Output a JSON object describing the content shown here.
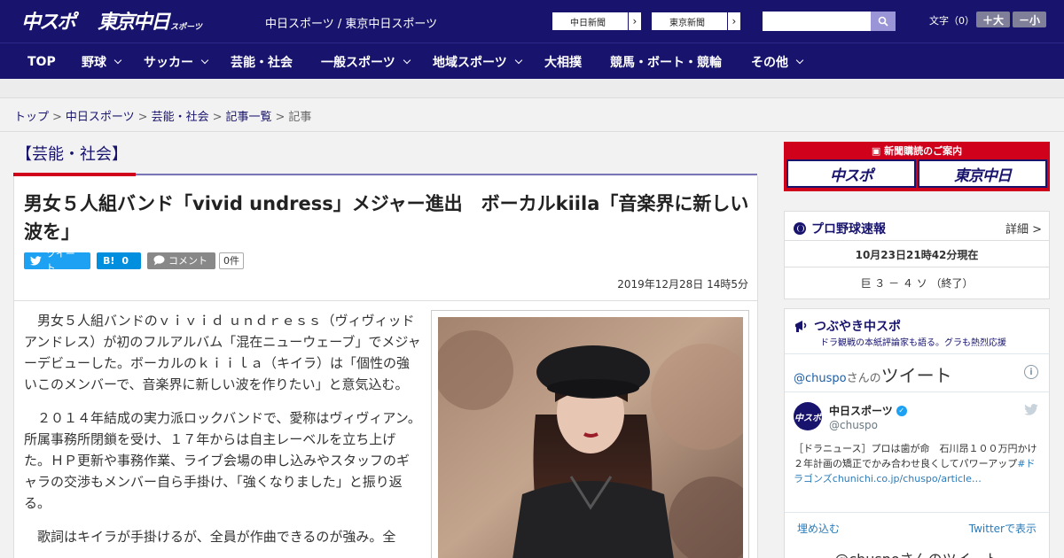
{
  "header": {
    "logo_chuspo": "中スポ",
    "logo_tokyo": "東京中日",
    "logo_tokyo_sub": "スポーツ",
    "site_title": "中日スポーツ / 東京中日スポーツ",
    "ext_links": [
      "中日新聞",
      "東京新聞"
    ],
    "search": {
      "placeholder": "",
      "value": ""
    },
    "font_label": "文字（0）",
    "font_big": "＋大",
    "font_small": "－小",
    "colors": {
      "navy": "#18146e",
      "red": "#d0021b"
    }
  },
  "nav": {
    "items": [
      {
        "label": "TOP",
        "has_menu": false
      },
      {
        "label": "野球",
        "has_menu": true
      },
      {
        "label": "サッカー",
        "has_menu": true
      },
      {
        "label": "芸能・社会",
        "has_menu": false
      },
      {
        "label": "一般スポーツ",
        "has_menu": true
      },
      {
        "label": "地域スポーツ",
        "has_menu": true
      },
      {
        "label": "大相撲",
        "has_menu": false
      },
      {
        "label": "競馬・ボート・競輪",
        "has_menu": false
      },
      {
        "label": "その他",
        "has_menu": true
      }
    ]
  },
  "breadcrumb": {
    "items": [
      "トップ",
      "中日スポーツ",
      "芸能・社会",
      "記事一覧"
    ],
    "current": "記事",
    "separator": ">"
  },
  "article": {
    "category": "【芸能・社会】",
    "headline": "男女５人組バンド「vivid undress」メジャー進出　ボーカルkiila「音楽界に新しい波を」",
    "share": {
      "tweet": "ツイート",
      "hatena": "B!",
      "hatena_count": "0",
      "comment": "コメント",
      "comment_count": "0件"
    },
    "date": "2019年12月28日 14時5分",
    "paragraphs": [
      "男女５人組バンドのｖｉｖｉｄ ｕｎｄｒｅｓｓ（ヴィヴィッドアンドレス）が初のフルアルバム「混在ニューウェーブ」でメジャーデビューした。ボーカルのｋｉｉｌａ（キイラ）は「個性の強いこのメンバーで、音楽界に新しい波を作りたい」と意気込む。",
      "２０１４年結成の実力派ロックバンドで、愛称はヴィヴィアン。所属事務所閉鎖を受け、１７年からは自主レーベルを立ち上げた。ＨＰ更新や事務作業、ライブ会場の申し込みやスタッフのギャラの交渉もメンバー自ら手掛け、「強くなりました」と振り返る。",
      "歌詞はキイラが手掛けるが、全員が作曲できるのが強み。全"
    ]
  },
  "sidebar": {
    "subscribe": {
      "caption": "新聞購読のご案内",
      "box1": "中スポ",
      "box2": "東京中日"
    },
    "baseball": {
      "title": "プロ野球速報",
      "more": "詳細 >",
      "updated": "10月23日21時42分現在",
      "score": "巨 ３ － ４ ソ （終了）"
    },
    "tweets": {
      "title": "つぶやき中スポ",
      "subtitle": "ドラ観戦の本紙評論家も語る。グラも熱烈応援",
      "handle_prefix": "@chuspo",
      "handle_suffix": "さんの",
      "heading_big": "ツイート",
      "account_name": "中日スポーツ",
      "account_handle": "@chuspo",
      "avatar_text": "中スポ",
      "tweet_text": "［ドラニュース］プロは歯が命　石川昂１００万円かけ２年計画の矯正でかみ合わせ良くしてパワーアップ",
      "tweet_tag": "#ドラゴンズ",
      "tweet_link": "chunichi.co.jp/chuspo/article…",
      "embed": "埋め込む",
      "view_on": "Twitterで表示",
      "more_title": "@chuspoさんのツイート"
    }
  }
}
